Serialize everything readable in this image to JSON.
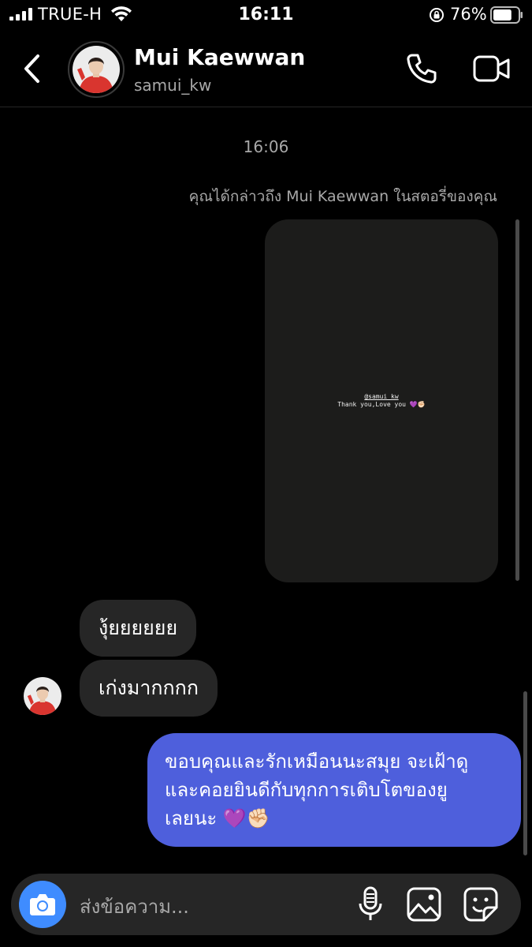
{
  "status_bar": {
    "carrier": "TRUE-H",
    "time": "16:11",
    "battery_percent": "76%",
    "battery_level": 0.76
  },
  "header": {
    "name": "Mui Kaewwan",
    "handle": "samui_kw",
    "icons": [
      "back-chevron-icon",
      "phone-icon",
      "video-camera-icon"
    ]
  },
  "chat": {
    "timestamp": "16:06",
    "mention_notice": "คุณได้กล่าวถึง Mui Kaewwan ในสตอรี่ของคุณ",
    "story": {
      "mention_tag": "@samui_kw",
      "caption": "Thank you,Love you",
      "caption_emoji": "💜✊🏻"
    },
    "incoming": [
      "งุ้ยยยยยย",
      "เก่งมากกกก"
    ],
    "outgoing": {
      "lines": [
        "ขอบคุณและรักเหมือนนะสมุย จะเฝ้าดู",
        "และคอยยินดีกับทุกการเติบโตของยู",
        "เลยนะ 💜✊🏻"
      ],
      "color": "#4e5fdc"
    }
  },
  "composer": {
    "placeholder": "ส่งข้อความ...",
    "accent": "#3f8cff",
    "icons": [
      "camera-icon",
      "microphone-icon",
      "gallery-icon",
      "sticker-icon"
    ]
  }
}
